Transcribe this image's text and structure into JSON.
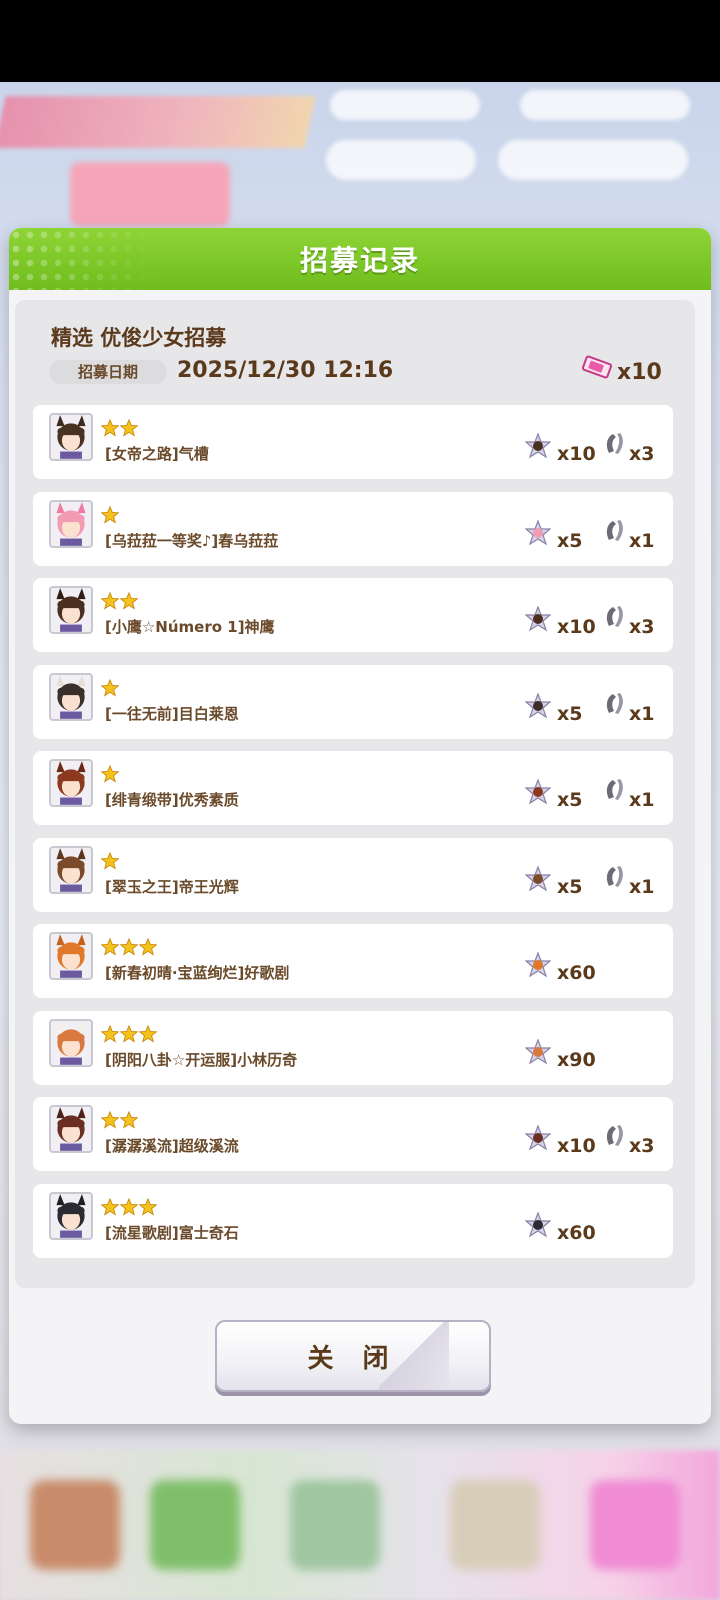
{
  "dialog": {
    "title": "招募记录",
    "pool_name": "精选 优俊少女招募",
    "date_label": "招募日期",
    "date_value": "2025/12/30  12:16",
    "ticket_icon": "ticket-icon",
    "ticket_count": "x10",
    "close_label": "关 闭"
  },
  "rows": [
    {
      "stars": 2,
      "name": "[女帝之路]气槽",
      "piece": "x10",
      "shoe": "x3",
      "hair": "#4a3222",
      "ear": "#3b2a1d"
    },
    {
      "stars": 1,
      "name": "[乌菈菈一等奖♪]春乌菈菈",
      "piece": "x5",
      "shoe": "x1",
      "hair": "#f29cb3",
      "ear": "#f07aa0"
    },
    {
      "stars": 2,
      "name": "[小鹰☆Número 1]神鹰",
      "piece": "x10",
      "shoe": "x3",
      "hair": "#4b3020",
      "ear": "#2e1e14"
    },
    {
      "stars": 1,
      "name": "[一往无前]目白莱恩",
      "piece": "x5",
      "shoe": "x1",
      "hair": "#3b2f2c",
      "ear": "#e6ddd3"
    },
    {
      "stars": 1,
      "name": "[绯青缎带]优秀素质",
      "piece": "x5",
      "shoe": "x1",
      "hair": "#8b3a1f",
      "ear": "#6a2a14"
    },
    {
      "stars": 1,
      "name": "[翠玉之王]帝王光辉",
      "piece": "x5",
      "shoe": "x1",
      "hair": "#7a4a2a",
      "ear": "#5d3620"
    },
    {
      "stars": 3,
      "name": "[新春初晴·宝蓝绚烂]好歌剧",
      "piece": "x60",
      "shoe": "",
      "hair": "#e0782a",
      "ear": "#c7621c"
    },
    {
      "stars": 3,
      "name": "[阴阳八卦☆开运服]小林历奇",
      "piece": "x90",
      "shoe": "",
      "hair": "#d9793e",
      "ear": "#f4f0ea"
    },
    {
      "stars": 2,
      "name": "[潺潺溪流]超级溪流",
      "piece": "x10",
      "shoe": "x3",
      "hair": "#6a2f22",
      "ear": "#4e2218"
    },
    {
      "stars": 3,
      "name": "[流星歌剧]富士奇石",
      "piece": "x60",
      "shoe": "",
      "hair": "#2b2b33",
      "ear": "#1e1e24"
    }
  ],
  "colors": {
    "header_green": "#7cc82a",
    "text_brown": "#5b3a1c",
    "star_gold": "#f5c21b"
  }
}
